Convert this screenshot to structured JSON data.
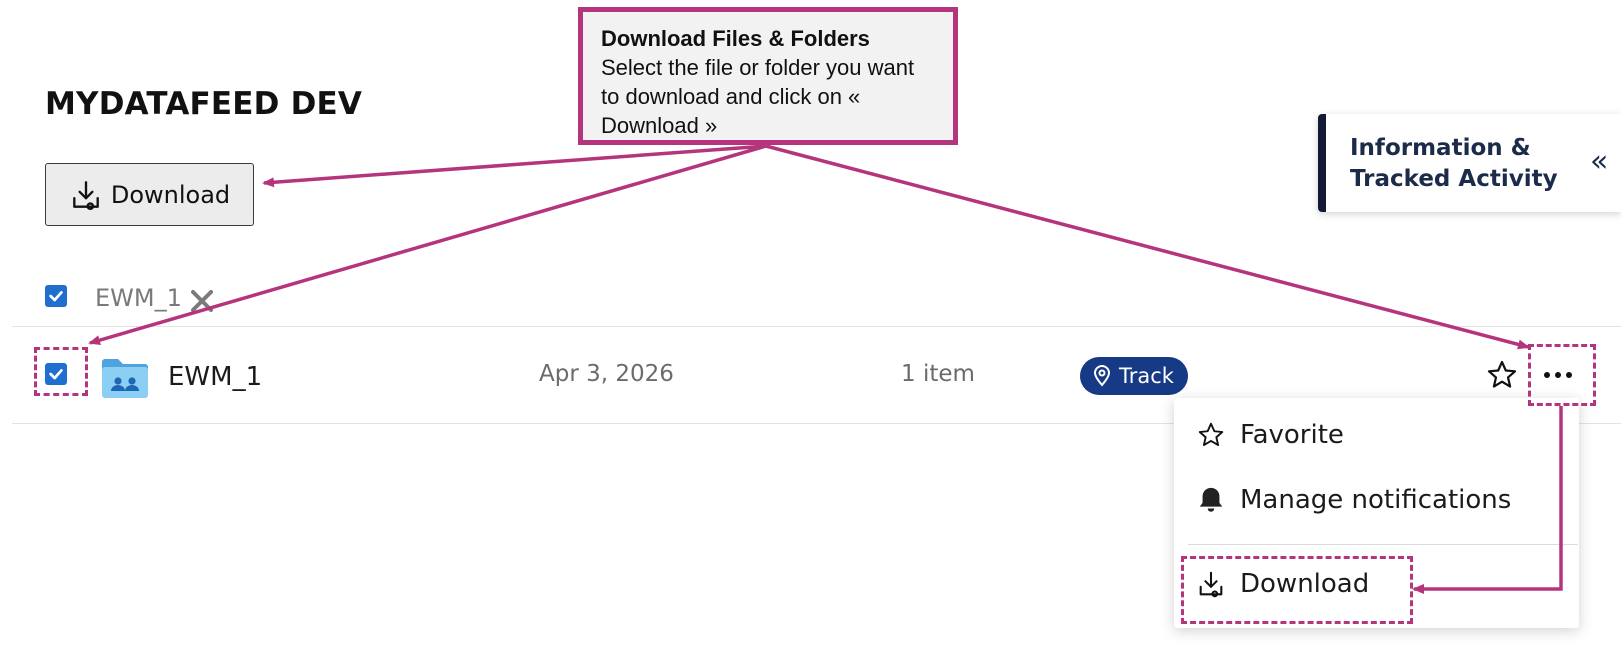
{
  "page": {
    "title": "MYDATAFEED DEV"
  },
  "toolbar": {
    "download_label": "Download"
  },
  "selection": {
    "label": "EWM_1"
  },
  "row": {
    "name": "EWM_1",
    "date": "Apr 3, 2026",
    "items": "1 item",
    "track_label": "Track"
  },
  "info_panel": {
    "title": "Information & Tracked Activity",
    "chevron": "«"
  },
  "context_menu": {
    "favorite": "Favorite",
    "manage_notifications": "Manage notifications",
    "download": "Download"
  },
  "callout": {
    "title": "Download Files & Folders",
    "body": "Select the file or folder you want to download and click on « Download »"
  },
  "colors": {
    "accent": "#b5357d",
    "checkbox": "#1f6fd1",
    "track_pill": "#173a86",
    "panel_border": "#131a36"
  },
  "icons": [
    "download-icon",
    "check-icon",
    "close-icon",
    "shared-folder-icon",
    "location-pin-icon",
    "star-icon",
    "more-icon",
    "bell-icon",
    "chevron-double-left-icon"
  ]
}
